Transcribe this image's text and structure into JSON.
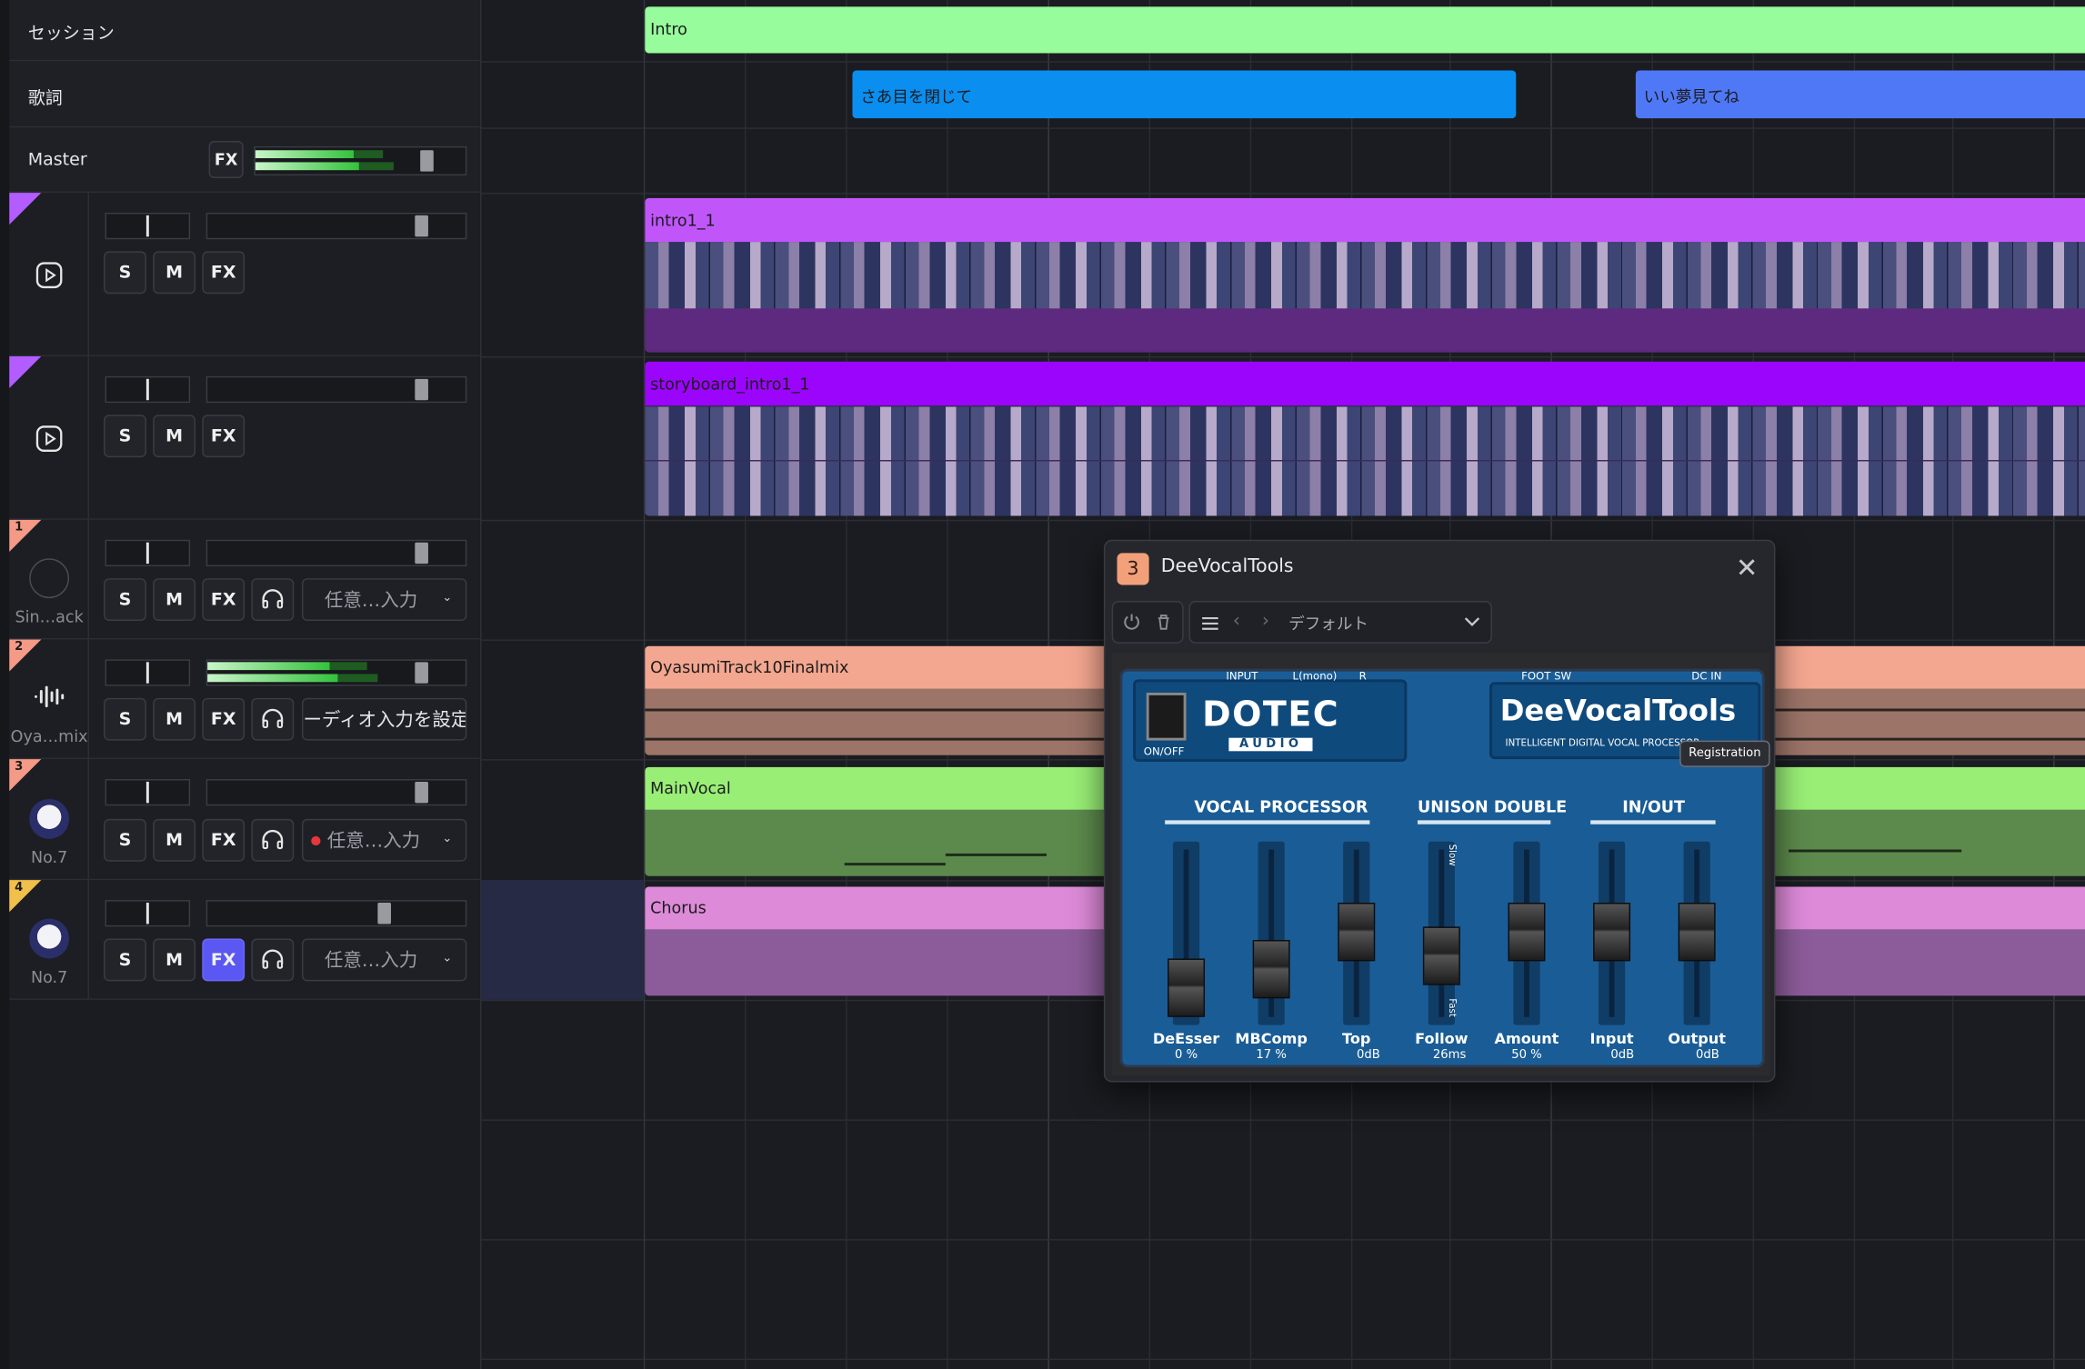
{
  "header_rows": {
    "session_label": "セッション",
    "lyrics_label": "歌詞",
    "master_label": "Master",
    "master_fx": "FX"
  },
  "tracks": [
    {
      "kind": "video",
      "solo": "S",
      "mute": "M",
      "fx": "FX",
      "color": "#b35cff"
    },
    {
      "kind": "video",
      "solo": "S",
      "mute": "M",
      "fx": "FX",
      "color": "#b35cff"
    },
    {
      "number": "1",
      "name": "Sin…ack",
      "solo": "S",
      "mute": "M",
      "fx": "FX",
      "input": "任意…入力",
      "color": "#f49a86"
    },
    {
      "number": "2",
      "name": "Oya…mix",
      "solo": "S",
      "mute": "M",
      "fx": "FX",
      "input": "ーディオ入力を設定",
      "color": "#f49a86"
    },
    {
      "number": "3",
      "name": "No.7",
      "solo": "S",
      "mute": "M",
      "fx": "FX",
      "input": "任意…入力",
      "color": "#f49a86"
    },
    {
      "number": "4",
      "name": "No.7",
      "solo": "S",
      "mute": "M",
      "fx": "FX",
      "input": "任意…入力",
      "color": "#f1c04b"
    }
  ],
  "clips": {
    "session": "Intro",
    "lyric1": "さあ目を閉じて",
    "lyric2": "いい夢見てね",
    "video1": "intro1_1",
    "video2": "storyboard_intro1_1",
    "audio1": "OyasumiTrack10Finalmix",
    "audio2": "MainVocal",
    "audio3": "Chorus"
  },
  "plugin": {
    "badge": "3",
    "title": "DeeVocalTools",
    "preset": "デフォルト",
    "brand_top": "DOTEC",
    "brand_bottom": "AUDIO",
    "onoff": "ON/OFF",
    "input_label": "INPUT",
    "lmono": "L(mono)",
    "r": "R",
    "footsw": "FOOT SW",
    "dcin": "DC IN",
    "product": "DeeVocalTools",
    "subtitle": "INTELLIGENT DIGITAL VOCAL PROCESSOR",
    "registration": "Registration",
    "sections": [
      "VOCAL PROCESSOR",
      "UNISON DOUBLE",
      "IN/OUT"
    ],
    "slow": "Slow",
    "fast": "Fast",
    "knobs": [
      {
        "label": "DeEsser",
        "value": "0 %"
      },
      {
        "label": "MBComp",
        "value": "17 %"
      },
      {
        "label": "Top",
        "value": "0dB"
      },
      {
        "label": "Follow",
        "value": "26ms"
      },
      {
        "label": "Amount",
        "value": "50 %"
      },
      {
        "label": "Input",
        "value": "0dB"
      },
      {
        "label": "Output",
        "value": "0dB"
      }
    ]
  }
}
